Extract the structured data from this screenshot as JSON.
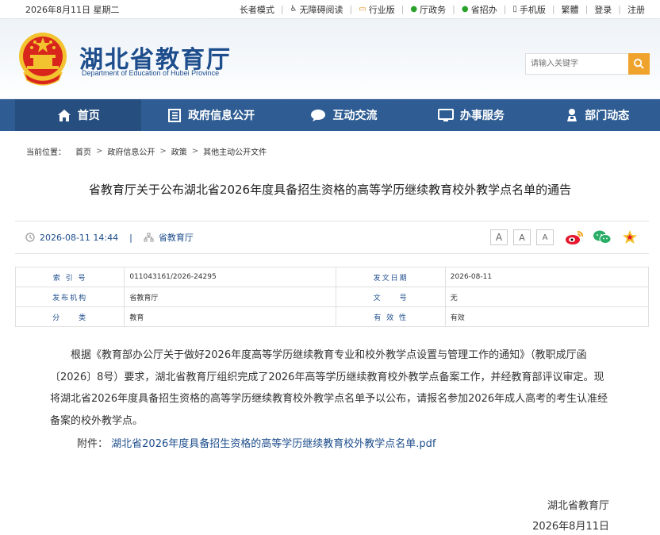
{
  "topbar": {
    "date": "2026年8月11日 星期二",
    "links": [
      "长者模式",
      "无障碍阅读",
      "行业版",
      "厅政务",
      "省招办",
      "手机版",
      "繁體",
      "登录",
      "注册"
    ]
  },
  "header": {
    "title": "湖北省教育厅",
    "subtitle": "Department of Education of Hubei Province",
    "search_placeholder": "请输入关键字"
  },
  "nav": [
    {
      "label": "首页"
    },
    {
      "label": "政府信息公开"
    },
    {
      "label": "互动交流"
    },
    {
      "label": "办事服务"
    },
    {
      "label": "部门动态"
    }
  ],
  "breadcrumb": {
    "prefix": "当前位置：",
    "items": [
      "首页",
      "政府信息公开",
      "政策",
      "其他主动公开文件"
    ]
  },
  "article": {
    "title": "省教育厅关于公布湖北省2026年度具备招生资格的高等学历继续教育校外教学点名单的通告",
    "datetime": "2026-08-11 14:44",
    "divider": "|",
    "source": "省教育厅",
    "font_buttons": [
      "A",
      "A",
      "A"
    ],
    "info": [
      {
        "k1": "索 引 号",
        "v1": "011043161/2026-24295",
        "k2": "发文日期",
        "v2": "2026-08-11"
      },
      {
        "k1": "发布机构",
        "v1": "省教育厅",
        "k2": "文　　号",
        "v2": "无"
      },
      {
        "k1": "分　　类",
        "v1": "教育",
        "k2": "有 效 性",
        "v2": "有效"
      }
    ],
    "body": "根据《教育部办公厅关于做好2026年度高等学历继续教育专业和校外教学点设置与管理工作的通知》（教职成厅函〔2026〕8号）要求，湖北省教育厅组织完成了2026年高等学历继续教育校外教学点备案工作，并经教育部评议审定。现将湖北省2026年度具备招生资格的高等学历继续教育校外教学点名单予以公布，请报名参加2026年成人高考的考生认准经备案的校外教学点。",
    "attachment_label": "附件：",
    "attachment_link": "湖北省2026年度具备招生资格的高等学历继续教育校外教学点名单.pdf",
    "sign_org": "湖北省教育厅",
    "sign_date": "2026年8月11日"
  },
  "colors": {
    "nav_bg": "#2f5d93",
    "accent": "#1d4d8c",
    "search_btn": "#f0a32c"
  }
}
